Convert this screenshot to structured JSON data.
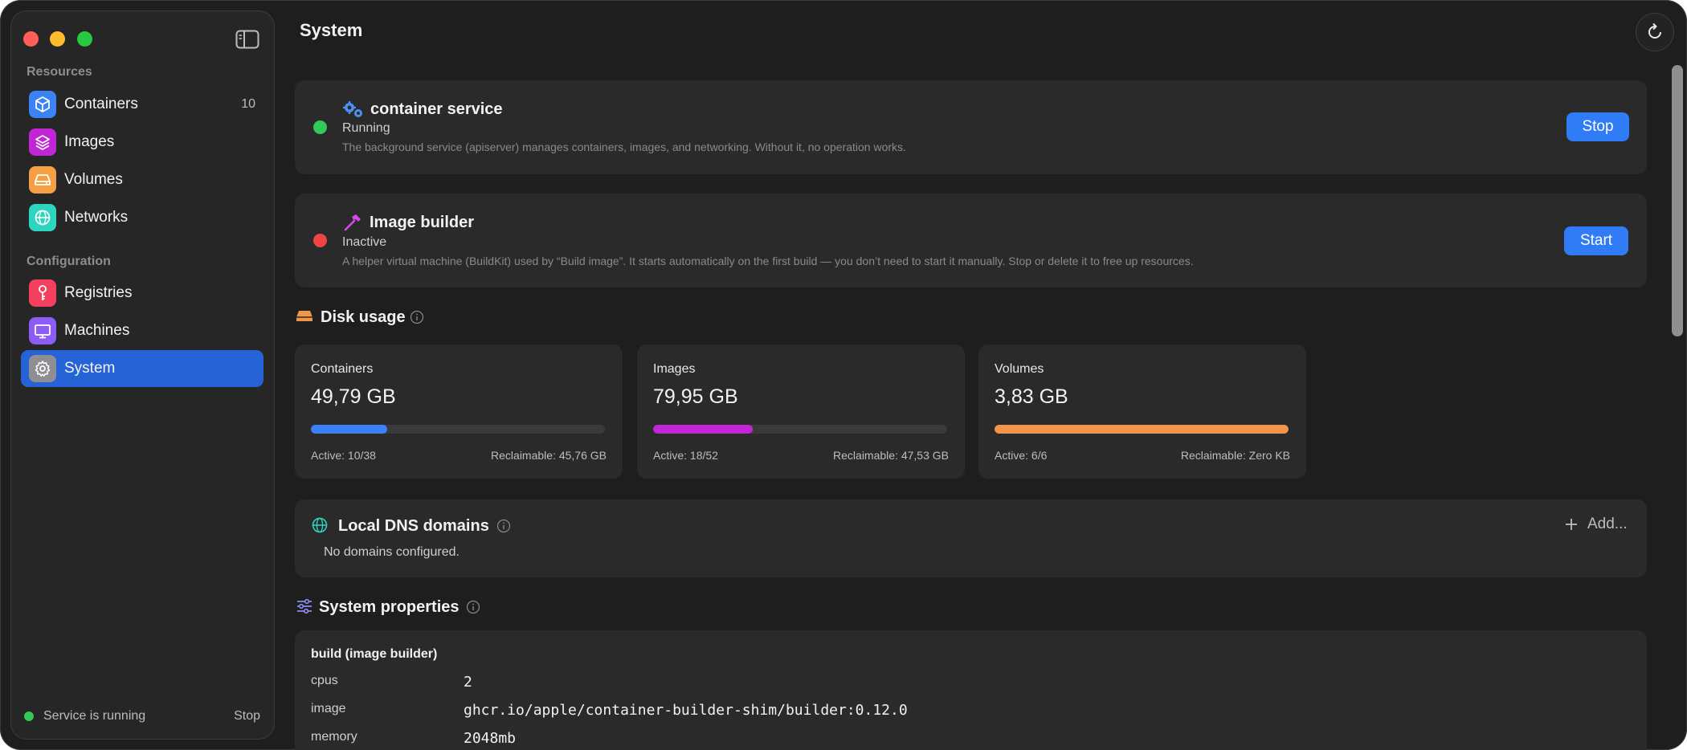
{
  "window": {
    "title": "System",
    "colors": {
      "accent": "#2f7cf6",
      "sidebar_active": "#2563d6",
      "running": "#34c759",
      "inactive": "#ef4444"
    }
  },
  "sidebar": {
    "sections": [
      {
        "label": "Resources",
        "items": [
          {
            "label": "Containers",
            "icon": "cube-icon",
            "count": "10",
            "color": "#3b82f6"
          },
          {
            "label": "Images",
            "icon": "layers-icon",
            "color": "#c026d3"
          },
          {
            "label": "Volumes",
            "icon": "drive-icon",
            "color": "#f59e42"
          },
          {
            "label": "Networks",
            "icon": "globe-icon",
            "color": "#2dd4bf"
          }
        ]
      },
      {
        "label": "Configuration",
        "items": [
          {
            "label": "Registries",
            "icon": "key-icon",
            "color": "#f43f5e"
          },
          {
            "label": "Machines",
            "icon": "display-icon",
            "color": "#8b5cf6"
          },
          {
            "label": "System",
            "icon": "gear-icon",
            "color": "#8e8e93",
            "active": true
          }
        ]
      }
    ],
    "footer": {
      "status": "Service is running",
      "stop_label": "Stop"
    }
  },
  "services": [
    {
      "title": "container service",
      "icon": "gears-icon",
      "state": "Running",
      "description": "The background service (apiserver) manages containers, images, and networking. Without it, no operation works.",
      "button": "Stop",
      "status_color": "#34c759"
    },
    {
      "title": "Image builder",
      "icon": "hammer-icon",
      "state": "Inactive",
      "description": "A helper virtual machine (BuildKit) used by “Build image”. It starts automatically on the first build — you don’t need to start it manually. Stop or delete it to free up resources.",
      "button": "Start",
      "status_color": "#ef4444"
    }
  ],
  "disk_usage": {
    "heading": "Disk usage",
    "cards": [
      {
        "name": "Containers",
        "size": "49,79 GB",
        "active": "Active: 10/38",
        "reclaimable": "Reclaimable: 45,76 GB",
        "fill": 0.26,
        "color": "#3b82f6"
      },
      {
        "name": "Images",
        "size": "79,95 GB",
        "active": "Active: 18/52",
        "reclaimable": "Reclaimable: 47,53 GB",
        "fill": 0.34,
        "color": "#c026d3"
      },
      {
        "name": "Volumes",
        "size": "3,83 GB",
        "active": "Active: 6/6",
        "reclaimable": "Reclaimable: Zero KB",
        "fill": 1.0,
        "color": "#f0954a"
      }
    ]
  },
  "dns": {
    "heading": "Local DNS domains",
    "empty_text": "No domains configured.",
    "add_label": "Add..."
  },
  "system_properties": {
    "heading": "System properties",
    "group_title": "build (image builder)",
    "rows": [
      {
        "key": "cpus",
        "value": "2"
      },
      {
        "key": "image",
        "value": "ghcr.io/apple/container-builder-shim/builder:0.12.0"
      },
      {
        "key": "memory",
        "value": "2048mb"
      }
    ]
  }
}
